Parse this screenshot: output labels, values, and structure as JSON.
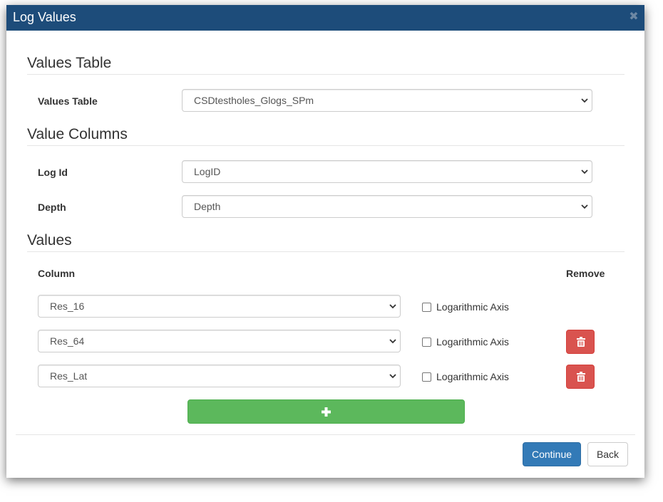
{
  "dialog": {
    "title": "Log Values"
  },
  "values_table_section": {
    "title": "Values Table",
    "field_label": "Values Table",
    "selected": "CSDtestholes_Glogs_SPm"
  },
  "value_columns_section": {
    "title": "Value Columns",
    "log_id": {
      "label": "Log Id",
      "selected": "LogID"
    },
    "depth": {
      "label": "Depth",
      "selected": "Depth"
    }
  },
  "values_section": {
    "title": "Values",
    "column_header": "Column",
    "remove_header": "Remove",
    "rows": [
      {
        "column": "Res_16",
        "log_axis_label": "Logarithmic Axis",
        "log_axis_checked": false,
        "removable": false
      },
      {
        "column": "Res_64",
        "log_axis_label": "Logarithmic Axis",
        "log_axis_checked": false,
        "removable": true
      },
      {
        "column": "Res_Lat",
        "log_axis_label": "Logarithmic Axis",
        "log_axis_checked": false,
        "removable": true
      }
    ]
  },
  "footer": {
    "continue_label": "Continue",
    "back_label": "Back"
  },
  "icons": {
    "close": "close-icon",
    "chevron": "chevron-down-icon",
    "remove": "trash-icon",
    "add": "plus-icon"
  },
  "colors": {
    "header_bg": "#1d4c7a",
    "primary": "#337ab7",
    "danger": "#d9534f",
    "success": "#5cb85c"
  }
}
